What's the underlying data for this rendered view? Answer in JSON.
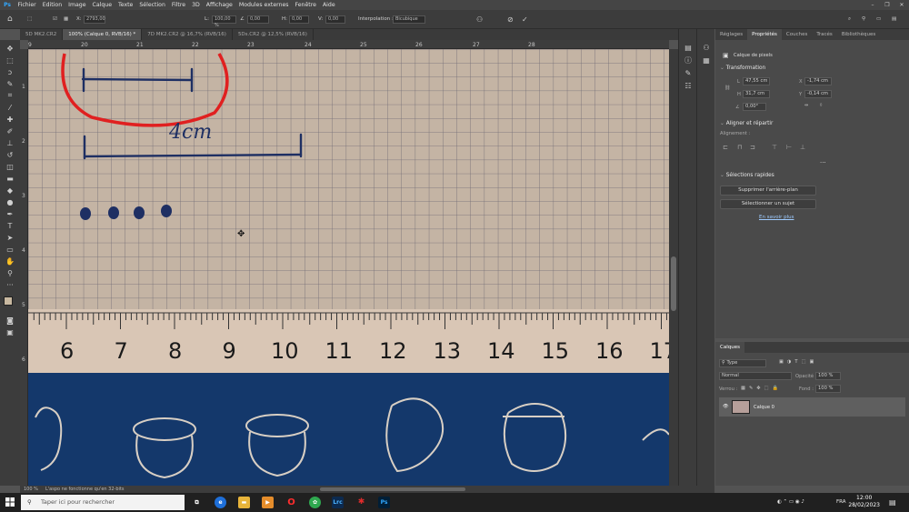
{
  "app": {
    "logo": "Ps"
  },
  "menu": [
    "Fichier",
    "Edition",
    "Image",
    "Calque",
    "Texte",
    "Sélection",
    "Filtre",
    "3D",
    "Affichage",
    "Modules externes",
    "Fenêtre",
    "Aide"
  ],
  "options": {
    "x_label": "X:",
    "x_value": "2793,00",
    "w_label": "L:",
    "w_value": "100,00 %",
    "angle_value": "0,00",
    "h_label": "H:",
    "h_value": "0,00",
    "v_label": "V:",
    "v_value": "0,00",
    "interpolation_label": "Interpolation :",
    "interpolation_value": "Bicubique"
  },
  "tabs": [
    "5D MK2.CR2",
    "100% (Calque 0, RVB/16) *",
    "7D MK2.CR2 @ 16,7% (RVB/16)",
    "5Ds.CR2 @ 12,5% (RVB/16)"
  ],
  "ruler_h": [
    "9",
    "20",
    "21",
    "22",
    "23",
    "24",
    "25",
    "26",
    "27",
    "28"
  ],
  "ruler_v": [
    "1",
    "2",
    "3",
    "4",
    "5",
    "6"
  ],
  "photo": {
    "handwriting": "4cm",
    "ruler_numbers": [
      "6",
      "7",
      "8",
      "9",
      "10",
      "11",
      "12",
      "13",
      "14",
      "15",
      "16",
      "17"
    ]
  },
  "panel_tabs": [
    "Réglages",
    "Propriétés",
    "Couches",
    "Tracés",
    "Bibliothèques"
  ],
  "properties": {
    "layer_type": "Calque de pixels",
    "transform_title": "Transformation",
    "l_label": "L",
    "l_value": "47,55 cm",
    "x_label": "X",
    "x_value": "-1,74 cm",
    "h_label": "H",
    "h_value": "31,7 cm",
    "y_label": "Y",
    "y_value": "-0,14 cm",
    "angle_value": "0,00°",
    "align_title": "Aligner et répartir",
    "align_label": "Alignement :",
    "more": "...",
    "quick_title": "Sélections rapides",
    "remove_bg": "Supprimer l'arrière-plan",
    "select_subject": "Sélectionner un sujet",
    "learn_more": "En savoir plus"
  },
  "layers": {
    "tab": "Calques",
    "filter_placeholder": "Type",
    "blend_mode": "Normal",
    "opacity_label": "Opacité :",
    "opacity_value": "100 %",
    "lock_label": "Verrou :",
    "fill_label": "Fond :",
    "fill_value": "100 %",
    "layer_name": "Calque 0"
  },
  "status": {
    "zoom": "100 %",
    "message": "L'aspo ne fonctionne qu'en 32-bits"
  },
  "taskbar": {
    "search_placeholder": "Taper ici pour rechercher",
    "lang": "FRA",
    "time": "12:00",
    "date": "28/02/2023"
  }
}
